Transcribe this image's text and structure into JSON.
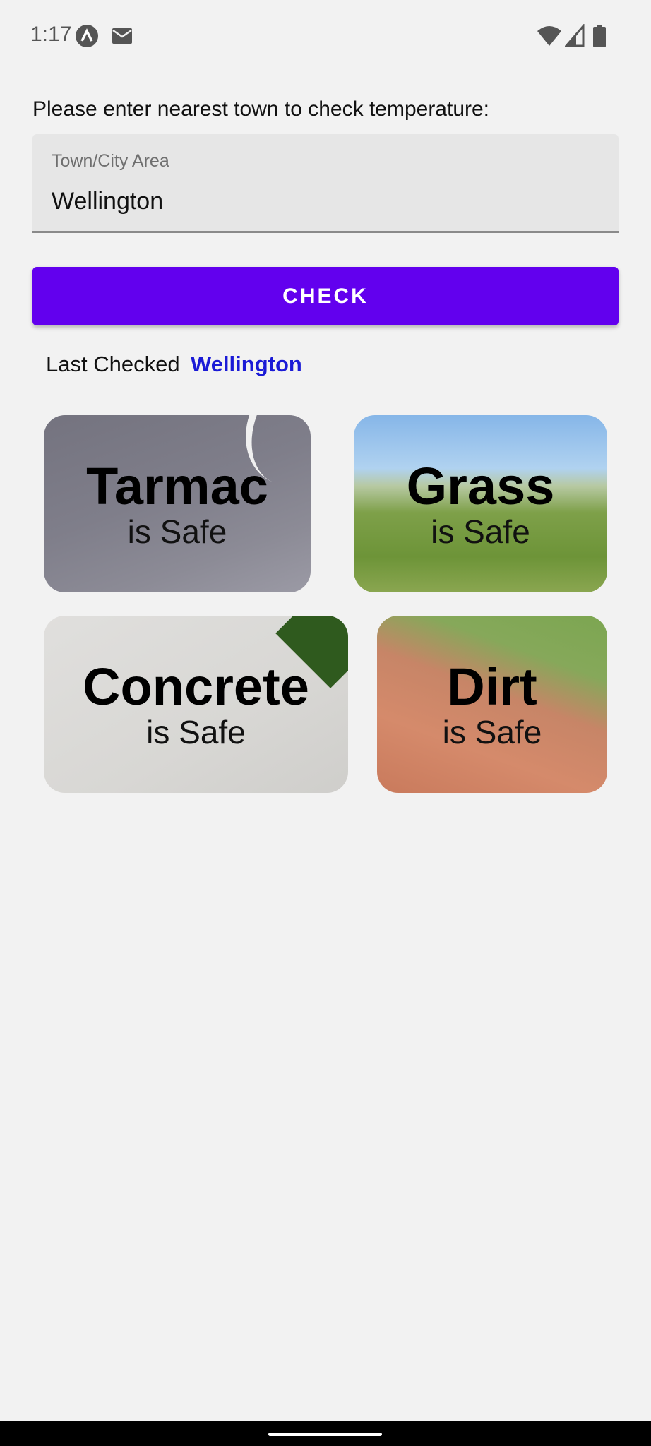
{
  "status_bar": {
    "time": "1:17",
    "icons": [
      "app-badge-icon",
      "mail-icon",
      "wifi-icon",
      "signal-icon",
      "battery-icon"
    ]
  },
  "form": {
    "prompt": "Please enter nearest town to check temperature:",
    "field_label": "Town/City Area",
    "field_value": "Wellington",
    "button_label": "CHECK"
  },
  "last_checked": {
    "label": "Last Checked",
    "town": "Wellington"
  },
  "surfaces": [
    {
      "name": "Tarmac",
      "status": "is Safe"
    },
    {
      "name": "Grass",
      "status": "is Safe"
    },
    {
      "name": "Concrete",
      "status": "is Safe"
    },
    {
      "name": "Dirt",
      "status": "is Safe"
    }
  ],
  "colors": {
    "button": "#6200ee",
    "last_town": "#1a1ad6",
    "background": "#f2f2f2"
  }
}
